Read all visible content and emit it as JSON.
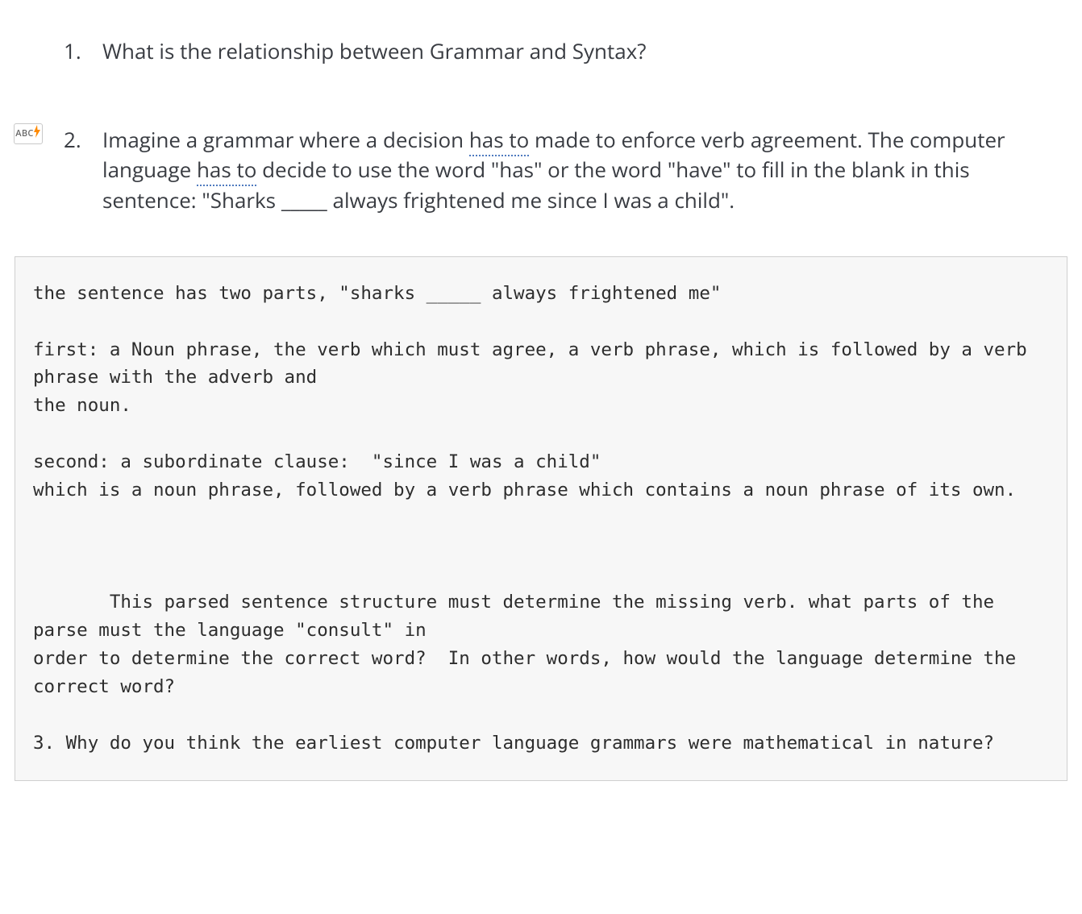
{
  "badge": {
    "label": "ABC"
  },
  "q1": {
    "num": "1.",
    "text": "What is the relationship between Grammar and Syntax?"
  },
  "q2": {
    "num": "2.",
    "p1a": "Imagine a grammar where a decision ",
    "hasto1": "has to",
    "p1b": " made to enforce verb agreement.  The computer language ",
    "hasto2": "has to",
    "p1c": " decide to use the word \"has\" or the word \"have\" to fill in the blank in this sentence: \"Sharks ",
    "blank": "_____",
    "p1d": " always frightened me since I was a child\"."
  },
  "code": {
    "l1": "the sentence has two parts, \"sharks _____ always frightened me\"",
    "l2": "",
    "l3": "first: a Noun phrase, the verb which must agree, a verb phrase, which is followed by a verb phrase with the adverb and",
    "l4": "the noun.",
    "l5": "",
    "l6": "second: a subordinate clause:  \"since I was a child\"",
    "l7": "which is a noun phrase, followed by a verb phrase which contains a noun phrase of its own.",
    "l8": "",
    "l9": "",
    "l10": "",
    "l11": "       This parsed sentence structure must determine the missing verb. what parts of the parse must the language \"consult\" in ",
    "l12": "order to determine the correct word?  In other words, how would the language determine the correct word?",
    "l13": "",
    "l14": "3. Why do you think the earliest computer language grammars were mathematical in nature?"
  }
}
